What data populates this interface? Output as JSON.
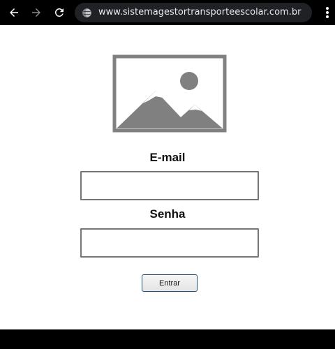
{
  "browser": {
    "url": "www.sistemagestortransporteescolar.com.br",
    "icons": {
      "back": "arrow-left-icon",
      "forward": "arrow-right-icon",
      "reload": "reload-icon",
      "site": "globe-icon",
      "menu": "more-vertical-icon"
    },
    "colors": {
      "bar": "#000000",
      "omnibox": "#202124",
      "url_text": "#e8eaed"
    }
  },
  "login": {
    "logo_icon": "image-placeholder-icon",
    "email_label": "E-mail",
    "email_value": "",
    "password_label": "Senha",
    "password_value": "",
    "submit_label": "Entrar"
  },
  "colors": {
    "logo_gray": "#808080",
    "field_border": "#767676",
    "button_border": "#1f4e79"
  }
}
